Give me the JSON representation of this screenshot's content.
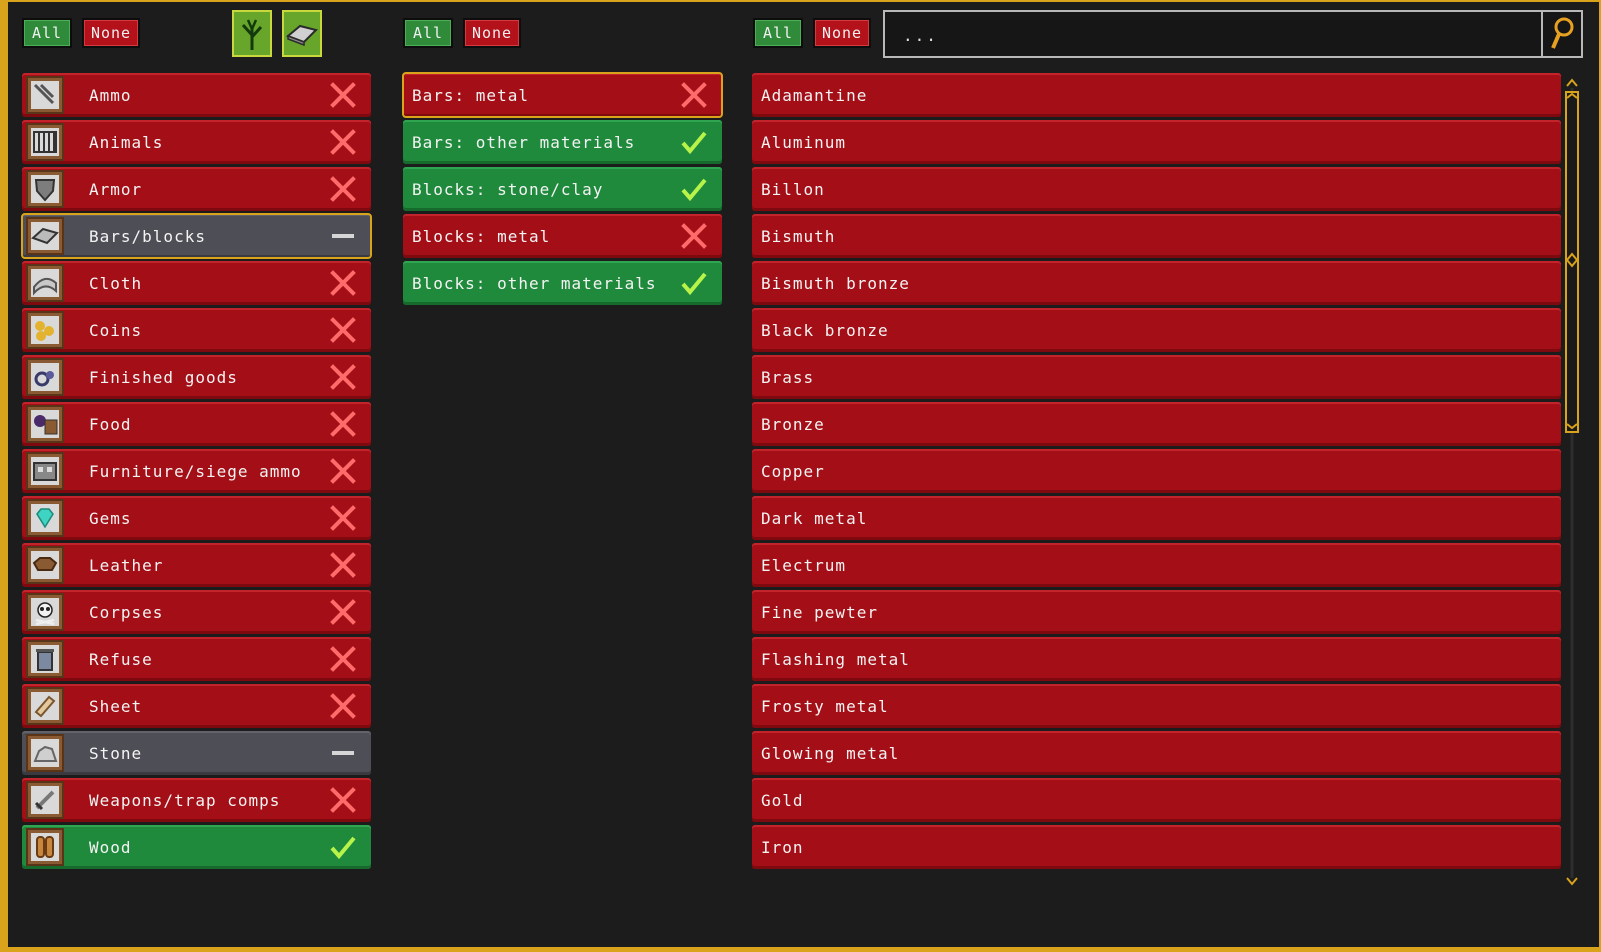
{
  "categories_toolbar": {
    "all_label": "All",
    "none_label": "None"
  },
  "subcategories_toolbar": {
    "all_label": "All",
    "none_label": "None"
  },
  "materials_toolbar": {
    "all_label": "All",
    "none_label": "None"
  },
  "filter_buttons": {
    "plant_icon": "plant-icon",
    "bar_icon": "bar-icon"
  },
  "search": {
    "value": "..."
  },
  "colors": {
    "enabled": "#1f8a3c",
    "disabled": "#a40e16",
    "partial": "#4e4e56",
    "selected_outline": "#d9a31b"
  },
  "categories": [
    {
      "label": "Ammo",
      "state": "off",
      "icon": "ammo-icon"
    },
    {
      "label": "Animals",
      "state": "off",
      "icon": "cage-icon"
    },
    {
      "label": "Armor",
      "state": "off",
      "icon": "shield-icon"
    },
    {
      "label": "Bars/blocks",
      "state": "partial",
      "icon": "bar-icon",
      "selected": true
    },
    {
      "label": "Cloth",
      "state": "off",
      "icon": "cloth-icon"
    },
    {
      "label": "Coins",
      "state": "off",
      "icon": "coins-icon"
    },
    {
      "label": "Finished goods",
      "state": "off",
      "icon": "goods-icon"
    },
    {
      "label": "Food",
      "state": "off",
      "icon": "food-icon"
    },
    {
      "label": "Furniture/siege ammo",
      "state": "off",
      "icon": "furniture-icon"
    },
    {
      "label": "Gems",
      "state": "off",
      "icon": "gem-icon"
    },
    {
      "label": "Leather",
      "state": "off",
      "icon": "leather-icon"
    },
    {
      "label": "Corpses",
      "state": "off",
      "icon": "skull-icon"
    },
    {
      "label": "Refuse",
      "state": "off",
      "icon": "trash-icon"
    },
    {
      "label": "Sheet",
      "state": "off",
      "icon": "scroll-icon"
    },
    {
      "label": "Stone",
      "state": "partial",
      "icon": "stone-icon"
    },
    {
      "label": "Weapons/trap comps",
      "state": "off",
      "icon": "sword-icon"
    },
    {
      "label": "Wood",
      "state": "on",
      "icon": "log-icon"
    }
  ],
  "subcategories": [
    {
      "label": "Bars: metal",
      "state": "off",
      "selected": true
    },
    {
      "label": "Bars: other materials",
      "state": "on"
    },
    {
      "label": "Blocks: stone/clay",
      "state": "on"
    },
    {
      "label": "Blocks: metal",
      "state": "off"
    },
    {
      "label": "Blocks: other materials",
      "state": "on"
    }
  ],
  "materials": [
    "Adamantine",
    "Aluminum",
    "Billon",
    "Bismuth",
    "Bismuth bronze",
    "Black bronze",
    "Brass",
    "Bronze",
    "Copper",
    "Dark metal",
    "Electrum",
    "Fine pewter",
    "Flashing metal",
    "Frosty metal",
    "Glowing metal",
    "Gold",
    "Iron"
  ]
}
